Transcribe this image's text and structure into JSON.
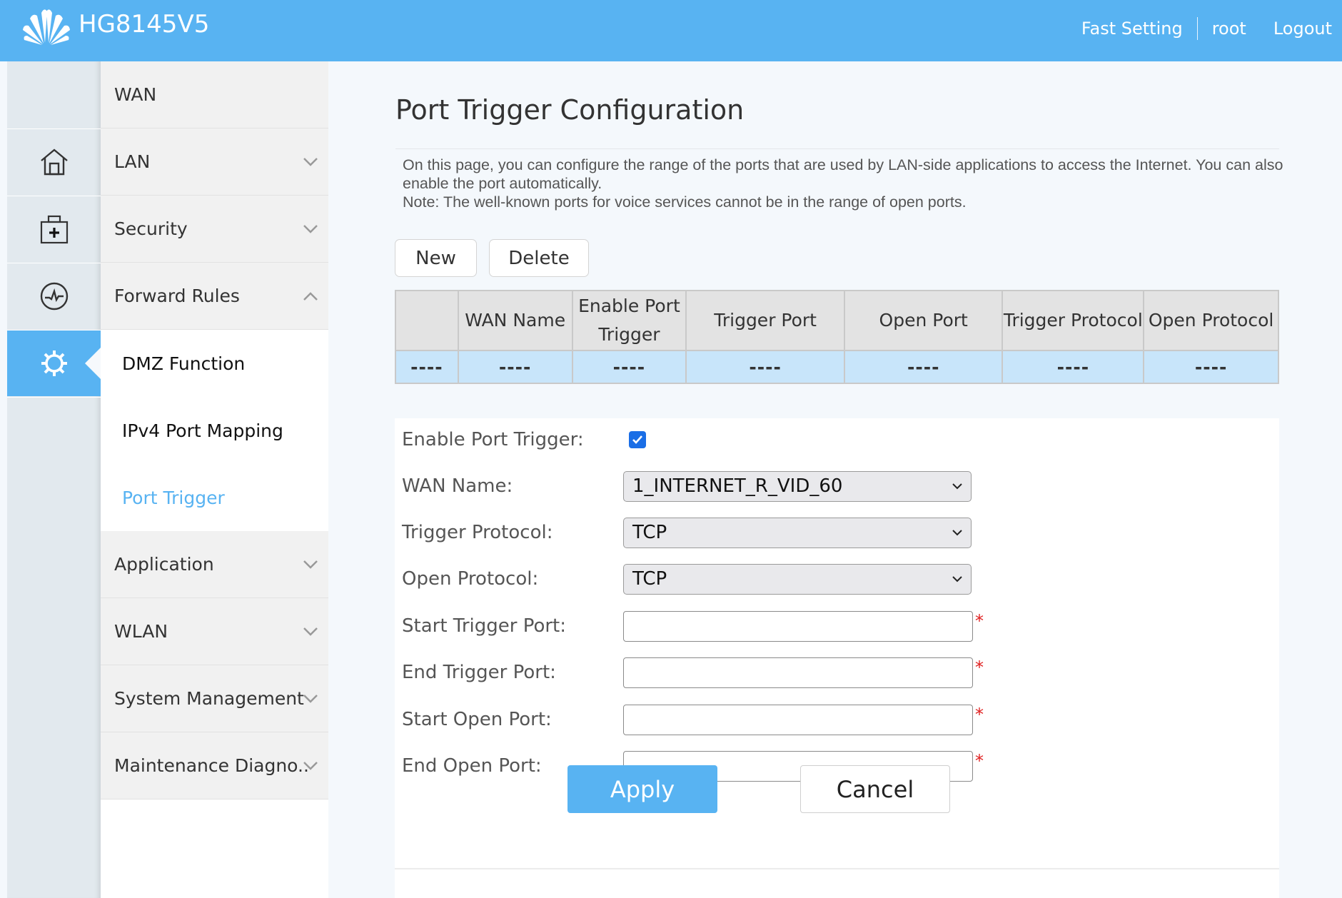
{
  "header": {
    "brand": "HG8145V5",
    "links": {
      "fast_setting": "Fast Setting",
      "user": "root",
      "logout": "Logout"
    },
    "accent_color": "#58b3f2"
  },
  "iconbar": {
    "icons": [
      "home-icon",
      "toolbox-icon",
      "diagnostics-icon",
      "gear-icon"
    ],
    "active": "gear-icon"
  },
  "menu": {
    "items": [
      {
        "label": "WAN",
        "expandable": false
      },
      {
        "label": "LAN",
        "expandable": true,
        "expanded": false
      },
      {
        "label": "Security",
        "expandable": true,
        "expanded": false
      },
      {
        "label": "Forward Rules",
        "expandable": true,
        "expanded": true
      },
      {
        "label": "Application",
        "expandable": true,
        "expanded": false
      },
      {
        "label": "WLAN",
        "expandable": true,
        "expanded": false
      },
      {
        "label": "System Management",
        "expandable": true,
        "expanded": false
      },
      {
        "label": "Maintenance Diagno..",
        "expandable": true,
        "expanded": false
      }
    ],
    "forward_rules_sub": [
      {
        "label": "DMZ Function",
        "active": false
      },
      {
        "label": "IPv4 Port Mapping",
        "active": false
      },
      {
        "label": "Port Trigger",
        "active": true
      }
    ]
  },
  "page": {
    "title": "Port Trigger Configuration",
    "description_line1": "On this page, you can configure the range of the ports that are used by LAN-side applications to access the Internet. You can also enable the port automatically.",
    "description_line2": "Note: The well-known ports for voice services cannot be in the range of open ports.",
    "buttons": {
      "new": "New",
      "delete": "Delete"
    }
  },
  "table": {
    "headers": [
      "",
      "WAN Name",
      "Enable Port Trigger",
      "Trigger Port",
      "Open Port",
      "Trigger Protocol",
      "Open Protocol"
    ],
    "rows": [
      [
        "----",
        "----",
        "----",
        "----",
        "----",
        "----",
        "----"
      ]
    ]
  },
  "form": {
    "enable_port_trigger": {
      "label": "Enable Port Trigger:",
      "checked": true
    },
    "wan_name": {
      "label": "WAN Name:",
      "value": "1_INTERNET_R_VID_60"
    },
    "trigger_protocol": {
      "label": "Trigger Protocol:",
      "value": "TCP"
    },
    "open_protocol": {
      "label": "Open Protocol:",
      "value": "TCP"
    },
    "start_trigger_port": {
      "label": "Start Trigger Port:",
      "value": "",
      "required": "*"
    },
    "end_trigger_port": {
      "label": "End Trigger Port:",
      "value": "",
      "required": "*"
    },
    "start_open_port": {
      "label": "Start Open Port:",
      "value": "",
      "required": "*"
    },
    "end_open_port": {
      "label": "End Open Port:",
      "value": "",
      "required": "*"
    },
    "apply": "Apply",
    "cancel": "Cancel"
  }
}
